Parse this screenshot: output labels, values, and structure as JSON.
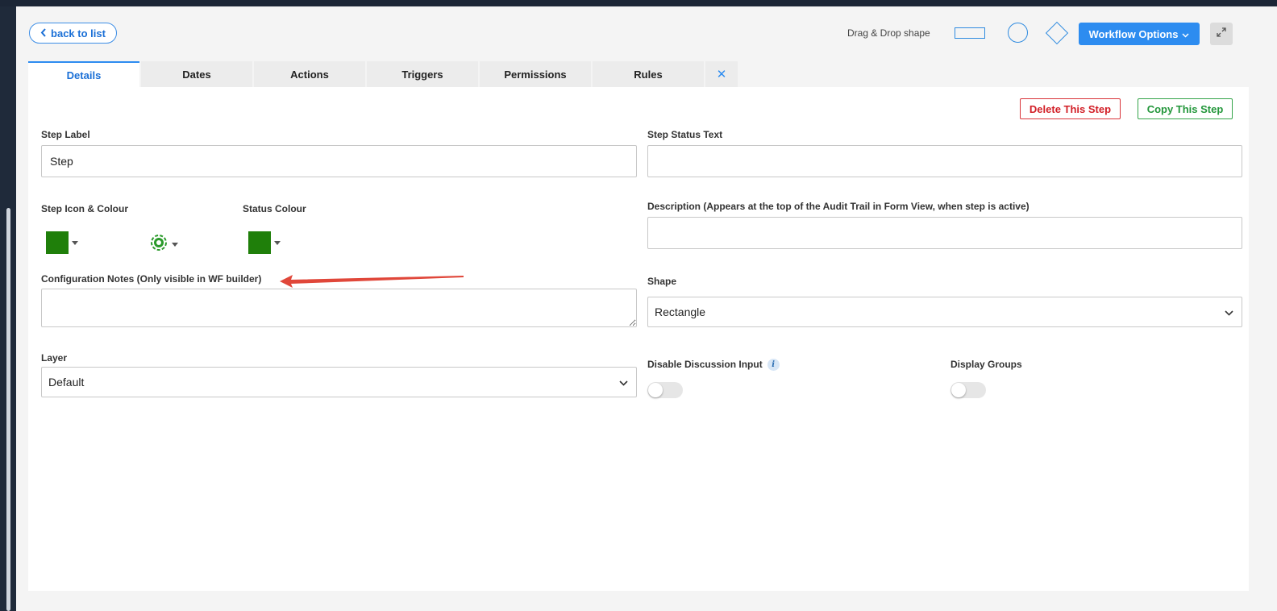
{
  "header": {
    "back_label": "back to list",
    "drag_drop_label": "Drag & Drop shape",
    "workflow_options_label": "Workflow Options"
  },
  "tabs": [
    {
      "label": "Details",
      "active": true
    },
    {
      "label": "Dates"
    },
    {
      "label": "Actions"
    },
    {
      "label": "Triggers"
    },
    {
      "label": "Permissions"
    },
    {
      "label": "Rules"
    }
  ],
  "actions": {
    "delete_label": "Delete This Step",
    "copy_label": "Copy This Step"
  },
  "form": {
    "step_label": {
      "label": "Step Label",
      "value": "Step"
    },
    "step_status_text": {
      "label": "Step Status Text",
      "value": ""
    },
    "step_icon_colour": {
      "label": "Step Icon & Colour",
      "colour": "#1f7f0a",
      "icon": "gear-icon"
    },
    "status_colour": {
      "label": "Status Colour",
      "colour": "#1f7f0a"
    },
    "description": {
      "label": "Description (Appears at the top of the Audit Trail in Form View, when step is active)",
      "value": ""
    },
    "config_notes": {
      "label": "Configuration Notes (Only visible in WF builder)",
      "value": ""
    },
    "shape": {
      "label": "Shape",
      "value": "Rectangle"
    },
    "layer": {
      "label": "Layer",
      "value": "Default"
    },
    "disable_discussion": {
      "label": "Disable Discussion Input",
      "on": false
    },
    "display_groups": {
      "label": "Display Groups",
      "on": false
    }
  },
  "colors": {
    "accent": "#2d8cf0",
    "danger": "#d21f27",
    "success": "#22963a",
    "annotation_arrow": "#e0473a"
  }
}
